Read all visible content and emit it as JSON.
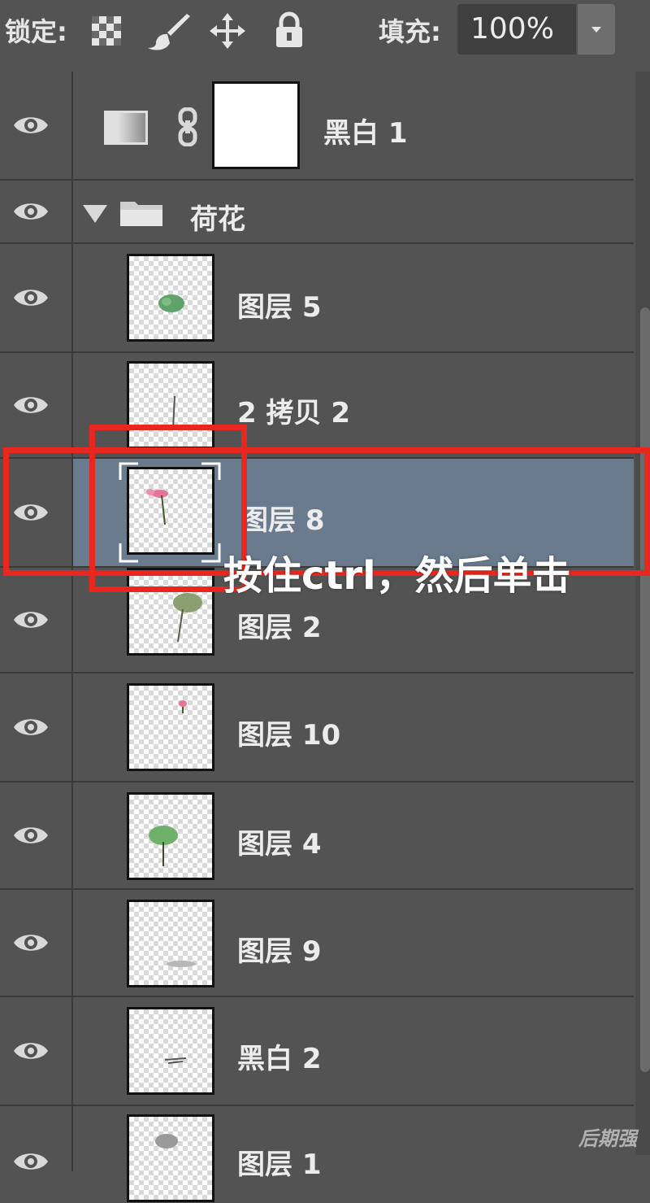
{
  "toolbar": {
    "lock_label": "锁定:",
    "fill_label": "填充:",
    "fill_value": "100%",
    "icons": [
      "lock-transparent-pixels-icon",
      "brush-icon",
      "move-icon",
      "lock-icon"
    ]
  },
  "layers": [
    {
      "name": "黑白 1",
      "kind": "adjustment"
    },
    {
      "name": "荷花",
      "kind": "group",
      "expanded": true
    },
    {
      "name": "图层 5",
      "kind": "pixel"
    },
    {
      "name": "2 拷贝 2",
      "kind": "pixel"
    },
    {
      "name": "图层 8",
      "kind": "pixel",
      "selected": true
    },
    {
      "name": "图层 2",
      "kind": "pixel"
    },
    {
      "name": "图层 10",
      "kind": "pixel"
    },
    {
      "name": "图层 4",
      "kind": "pixel"
    },
    {
      "name": "图层 9",
      "kind": "pixel"
    },
    {
      "name": "黑白 2",
      "kind": "pixel"
    },
    {
      "name": "图层 1",
      "kind": "pixel"
    }
  ],
  "annotation": {
    "text": "按住ctrl，然后单击",
    "color": "#e8281e"
  },
  "watermark": "后期强",
  "colors": {
    "panel_bg": "#535353",
    "selected_row": "#6a7b8e",
    "annotation_red": "#e8281e"
  }
}
